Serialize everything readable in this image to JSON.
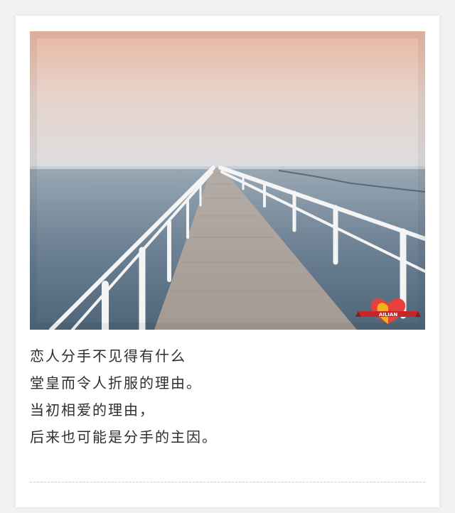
{
  "image": {
    "description_icon": "photo-pier-sea-icon",
    "logo_text": "AILIAN"
  },
  "quote": {
    "lines": [
      "恋人分手不见得有什么",
      "堂皇而令人折服的理由。",
      "当初相爱的理由，",
      "后来也可能是分手的主因。"
    ]
  },
  "colors": {
    "card": "#ffffff",
    "page_bg": "#f1f1f1",
    "text": "#2e2e2e",
    "divider": "#c9c9c9"
  }
}
